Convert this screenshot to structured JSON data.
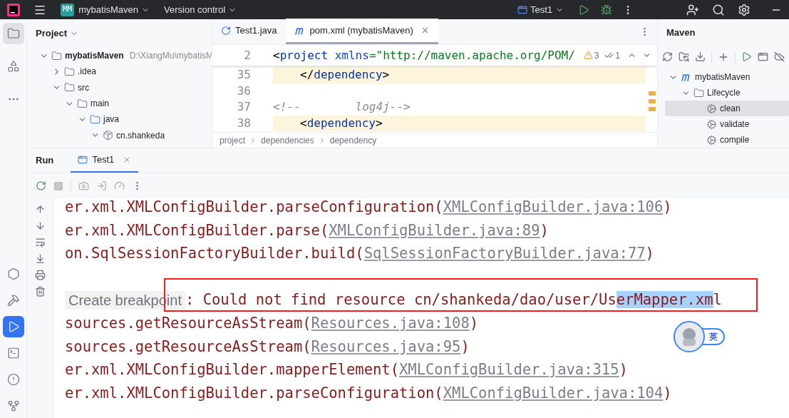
{
  "top_bar": {
    "project_badge": "MM",
    "project": "mybatisMaven",
    "vcs": "Version control",
    "run_config": "Test1"
  },
  "tool_strip_top": [
    {
      "kind": "project",
      "selected": true
    },
    {
      "kind": "structure",
      "selected": false
    },
    {
      "kind": "more",
      "selected": false
    }
  ],
  "tool_strip_bottom": [
    {
      "kind": "services",
      "selected": false
    },
    {
      "kind": "build",
      "selected": false
    },
    {
      "kind": "run",
      "selected": true
    },
    {
      "kind": "terminal",
      "selected": false
    },
    {
      "kind": "problems",
      "selected": false
    },
    {
      "kind": "vcs",
      "selected": false
    }
  ],
  "project_panel": {
    "title": "Project",
    "tree": [
      {
        "name": "mybatisMaven",
        "kind": "module",
        "path": "D:\\XiangMu\\mybatisM",
        "expanded": true,
        "children": [
          {
            "name": ".idea",
            "kind": "folder",
            "expanded": false
          },
          {
            "name": "src",
            "kind": "folder",
            "expanded": true,
            "children": [
              {
                "name": "main",
                "kind": "folder",
                "expanded": true,
                "children": [
                  {
                    "name": "java",
                    "kind": "source",
                    "expanded": true,
                    "children": [
                      {
                        "name": "cn.shankeda",
                        "kind": "package",
                        "expanded": true
                      }
                    ]
                  }
                ]
              }
            ]
          }
        ]
      }
    ]
  },
  "editor": {
    "tabs": [
      {
        "label": "Test1.java",
        "kind": "java",
        "selected": false
      },
      {
        "label": "pom.xml (mybatisMaven)",
        "kind": "maven",
        "selected": true
      }
    ],
    "sticky": {
      "number": "2",
      "parts": [
        {
          "kind": "punct",
          "text": "<"
        },
        {
          "kind": "tag",
          "text": "project "
        },
        {
          "kind": "attr",
          "text": "xmlns"
        },
        {
          "kind": "value",
          "text": "=\"http://maven.apache.org/POM/"
        }
      ]
    },
    "inspections": {
      "warnings": "3",
      "checks": "1"
    },
    "lines": [
      {
        "number": "35",
        "kind": "nested",
        "highlighted": true,
        "parts": [
          {
            "kind": "punct",
            "text": "</"
          },
          {
            "kind": "tag",
            "text": "dependency"
          },
          {
            "kind": "punct",
            "text": ">"
          }
        ]
      },
      {
        "number": "36",
        "kind": "empty",
        "highlighted": false
      },
      {
        "number": "37",
        "kind": "top",
        "highlighted": false,
        "parts": [
          {
            "kind": "comment",
            "text": "<!--        log4j-->"
          }
        ]
      },
      {
        "number": "38",
        "kind": "nested",
        "highlighted": true,
        "parts": [
          {
            "kind": "punct",
            "text": "<"
          },
          {
            "kind": "tag",
            "text": "dependency"
          },
          {
            "kind": "punct",
            "text": ">"
          }
        ]
      }
    ],
    "breadcrumbs": [
      "project",
      "dependencies",
      "dependency"
    ]
  },
  "maven_panel": {
    "title": "Maven",
    "tree": [
      {
        "name": "mybatisMaven",
        "kind": "maven",
        "expanded": true,
        "selected": false,
        "children": [
          {
            "name": "Lifecycle",
            "kind": "lifecycle",
            "expanded": true,
            "selected": false,
            "children": [
              {
                "name": "clean",
                "kind": "goal",
                "selected": true
              },
              {
                "name": "validate",
                "kind": "goal",
                "selected": false
              },
              {
                "name": "compile",
                "kind": "goal",
                "selected": false
              }
            ]
          }
        ]
      }
    ]
  },
  "run_panel": {
    "title": "Run",
    "tabs": [
      {
        "label": "Test1",
        "selected": true
      }
    ],
    "lines": [
      {
        "kind": "trace",
        "text": "er.xml.XMLConfigBuilder.parseConfiguration(",
        "link": "XMLConfigBuilder.java:106",
        "tail": ")"
      },
      {
        "kind": "trace",
        "text": "er.xml.XMLConfigBuilder.parse(",
        "link": "XMLConfigBuilder.java:89",
        "tail": ")"
      },
      {
        "kind": "trace",
        "text": "on.SqlSessionFactoryBuilder.build(",
        "link": "SqlSessionFactoryBuilder.java:77",
        "tail": ")"
      },
      {
        "kind": "blank"
      },
      {
        "kind": "error",
        "tooltip": "Create breakpoint",
        "text": ": Could not find resource cn/shankeda/dao/user/Us",
        "selection": "erMapper.xm",
        "tail": "l",
        "framed": true
      },
      {
        "kind": "trace",
        "text": "sources.getResourceAsStream(",
        "link": "Resources.java:108",
        "tail": ")"
      },
      {
        "kind": "trace",
        "text": "sources.getResourceAsStream(",
        "link": "Resources.java:95",
        "tail": ")"
      },
      {
        "kind": "trace",
        "text": "er.xml.XMLConfigBuilder.mapperElement(",
        "link": "XMLConfigBuilder.java:315",
        "tail": ")"
      },
      {
        "kind": "trace",
        "text": "er.xml.XMLConfigBuilder.parseConfiguration(",
        "link": "XMLConfigBuilder.java:104",
        "tail": ")"
      }
    ]
  },
  "ime": {
    "label": "英"
  }
}
